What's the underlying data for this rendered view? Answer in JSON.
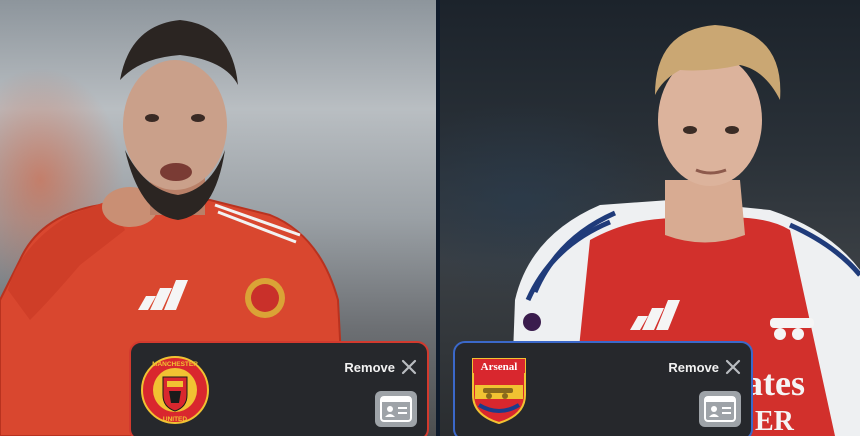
{
  "players": [
    {
      "club": "manchester-united",
      "accent": "#d23a2e",
      "crest_text_top": "MANCHESTER",
      "crest_text_bottom": "UNITED",
      "remove_label": "Remove"
    },
    {
      "club": "arsenal",
      "accent": "#3b68c9",
      "crest_text_top": "Arsenal",
      "remove_label": "Remove"
    }
  ],
  "jersey_text": {
    "right_sponsor": "ates",
    "right_sponsor_line2": "ER"
  },
  "icons": {
    "remove": "close-icon",
    "id_card": "id-card-icon"
  }
}
